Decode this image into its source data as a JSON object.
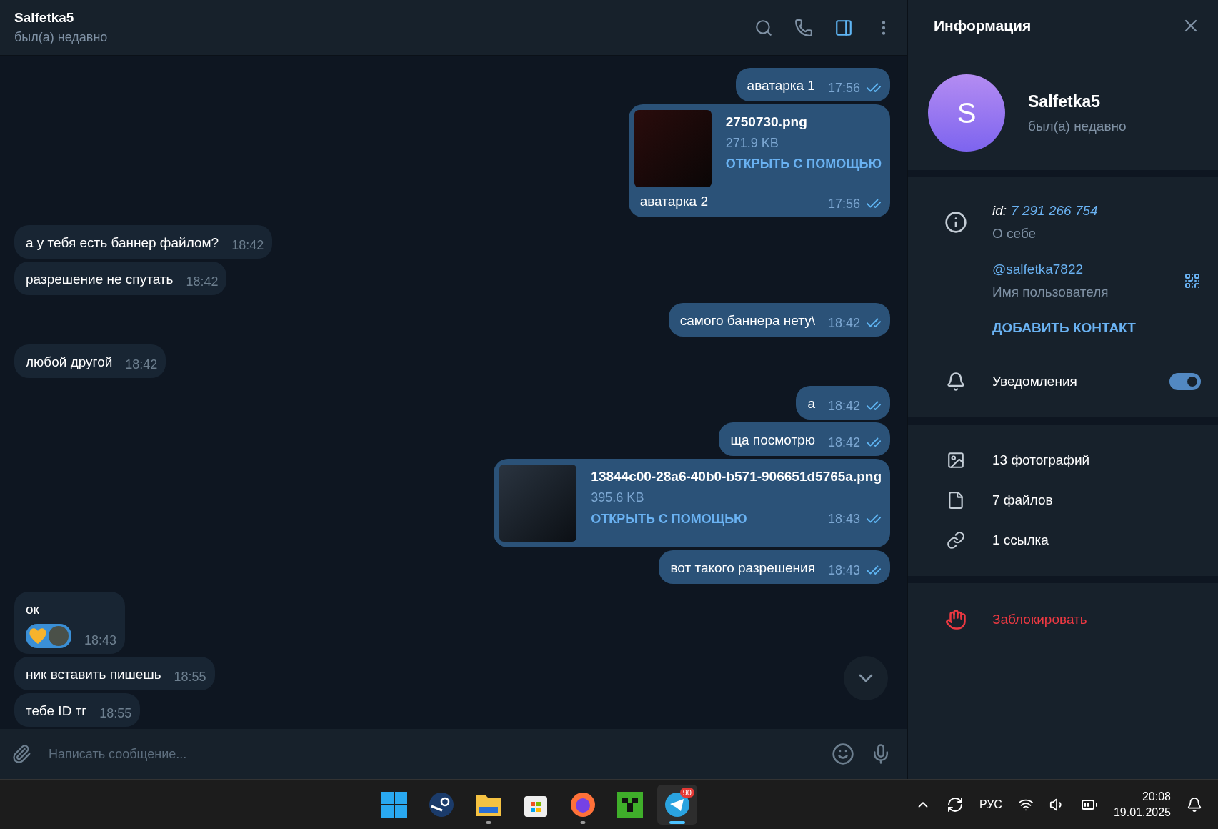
{
  "chat_header": {
    "name": "Salfetka5",
    "status": "был(а) недавно"
  },
  "messages": [
    {
      "kind": "text",
      "outgoing": true,
      "text": "аватарка 1",
      "time": "17:56",
      "read": true
    },
    {
      "kind": "file",
      "outgoing": true,
      "file_name": "2750730.png",
      "size": "271.9 KB",
      "action": "ОТКРЫТЬ С ПОМОЩЬЮ",
      "caption": "аватарка 2",
      "time": "17:56",
      "read": true
    },
    {
      "kind": "text",
      "outgoing": false,
      "text": "а у тебя есть баннер файлом?",
      "time": "18:42"
    },
    {
      "kind": "text",
      "outgoing": false,
      "text": "разрешение не спутать",
      "time": "18:42"
    },
    {
      "kind": "text",
      "outgoing": true,
      "text": "самого баннера нету\\",
      "time": "18:42",
      "read": true
    },
    {
      "kind": "text",
      "outgoing": false,
      "text": "любой другой",
      "time": "18:42"
    },
    {
      "kind": "text",
      "outgoing": true,
      "text": "а",
      "time": "18:42",
      "read": true
    },
    {
      "kind": "text",
      "outgoing": true,
      "text": "ща посмотрю",
      "time": "18:42",
      "read": true
    },
    {
      "kind": "file",
      "outgoing": true,
      "file_name": "13844c00-28a6-40b0-b571-906651d5765a.png",
      "size": "395.6 KB",
      "action": "ОТКРЫТЬ С ПОМОЩЬЮ",
      "time": "18:43",
      "read": true
    },
    {
      "kind": "text",
      "outgoing": true,
      "text": "вот такого разрешения",
      "time": "18:43",
      "read": true
    },
    {
      "kind": "reaction",
      "outgoing": false,
      "text": "ок",
      "time": "18:43"
    },
    {
      "kind": "text",
      "outgoing": false,
      "text": "ник вставить пишешь",
      "time": "18:55"
    },
    {
      "kind": "text",
      "outgoing": false,
      "text": "тебе ID тг",
      "time": "18:55"
    }
  ],
  "composer": {
    "placeholder": "Написать сообщение..."
  },
  "info_panel": {
    "title": "Информация",
    "name": "Salfetka5",
    "status": "был(а) недавно",
    "avatar_letter": "S",
    "id_label": "id:",
    "id_value": "7 291 266 754",
    "bio_caption": "О себе",
    "username": "@salfetka7822",
    "username_caption": "Имя пользователя",
    "add_contact": "ДОБАВИТЬ КОНТАКТ",
    "notifications": {
      "label": "Уведомления",
      "on": true
    },
    "media": [
      {
        "kind": "photos",
        "label": "13 фотографий"
      },
      {
        "kind": "files",
        "label": "7 файлов"
      },
      {
        "kind": "links",
        "label": "1 ссылка"
      }
    ],
    "block": "Заблокировать"
  },
  "taskbar": {
    "apps": [
      {
        "kind": "start",
        "running": false,
        "selected": false
      },
      {
        "kind": "steam",
        "running": false,
        "selected": false
      },
      {
        "kind": "folder",
        "running": true,
        "selected": false
      },
      {
        "kind": "store",
        "running": false,
        "selected": false
      },
      {
        "kind": "firefox",
        "running": true,
        "selected": false
      },
      {
        "kind": "creeper",
        "running": false,
        "selected": false
      },
      {
        "kind": "telegram",
        "running": true,
        "selected": true,
        "badge": "90"
      }
    ],
    "language": "РУС",
    "time": "20:08",
    "date": "19.01.2025"
  }
}
